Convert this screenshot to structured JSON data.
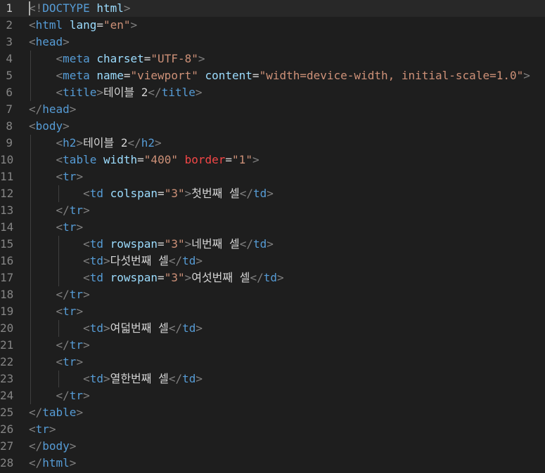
{
  "editor": {
    "language": "html",
    "current_line": 1,
    "colors": {
      "background": "#1e1e1e",
      "punctuation": "#808080",
      "tag": "#569cd6",
      "attribute": "#9cdcfe",
      "unknown_attribute": "#f44747",
      "string": "#ce9178",
      "text": "#d4d4d4",
      "line_number": "#858585"
    },
    "lines": [
      {
        "n": "1",
        "indent": "",
        "tokens": [
          [
            "punct",
            "<!"
          ],
          [
            "tag",
            "DOCTYPE"
          ],
          [
            "text",
            " "
          ],
          [
            "attr",
            "html"
          ],
          [
            "punct",
            ">"
          ]
        ]
      },
      {
        "n": "2",
        "indent": "",
        "tokens": [
          [
            "punct",
            "<"
          ],
          [
            "tag",
            "html"
          ],
          [
            "text",
            " "
          ],
          [
            "attr",
            "lang"
          ],
          [
            "text",
            "="
          ],
          [
            "str",
            "\"en\""
          ],
          [
            "punct",
            ">"
          ]
        ]
      },
      {
        "n": "3",
        "indent": "",
        "tokens": [
          [
            "punct",
            "<"
          ],
          [
            "tag",
            "head"
          ],
          [
            "punct",
            ">"
          ]
        ]
      },
      {
        "n": "4",
        "indent": "    ",
        "tokens": [
          [
            "punct",
            "<"
          ],
          [
            "tag",
            "meta"
          ],
          [
            "text",
            " "
          ],
          [
            "attr",
            "charset"
          ],
          [
            "text",
            "="
          ],
          [
            "str",
            "\"UTF-8\""
          ],
          [
            "punct",
            ">"
          ]
        ]
      },
      {
        "n": "5",
        "indent": "    ",
        "tokens": [
          [
            "punct",
            "<"
          ],
          [
            "tag",
            "meta"
          ],
          [
            "text",
            " "
          ],
          [
            "attr",
            "name"
          ],
          [
            "text",
            "="
          ],
          [
            "str",
            "\"viewport\""
          ],
          [
            "text",
            " "
          ],
          [
            "attr",
            "content"
          ],
          [
            "text",
            "="
          ],
          [
            "str",
            "\"width=device-width, initial-scale=1.0\""
          ],
          [
            "punct",
            ">"
          ]
        ]
      },
      {
        "n": "6",
        "indent": "    ",
        "tokens": [
          [
            "punct",
            "<"
          ],
          [
            "tag",
            "title"
          ],
          [
            "punct",
            ">"
          ],
          [
            "text",
            "테이블 2"
          ],
          [
            "punct",
            "</"
          ],
          [
            "tag",
            "title"
          ],
          [
            "punct",
            ">"
          ]
        ]
      },
      {
        "n": "7",
        "indent": "",
        "tokens": [
          [
            "punct",
            "</"
          ],
          [
            "tag",
            "head"
          ],
          [
            "punct",
            ">"
          ]
        ]
      },
      {
        "n": "8",
        "indent": "",
        "tokens": [
          [
            "punct",
            "<"
          ],
          [
            "tag",
            "body"
          ],
          [
            "punct",
            ">"
          ]
        ]
      },
      {
        "n": "9",
        "indent": "    ",
        "tokens": [
          [
            "punct",
            "<"
          ],
          [
            "tag",
            "h2"
          ],
          [
            "punct",
            ">"
          ],
          [
            "text",
            "테이블 2"
          ],
          [
            "punct",
            "</"
          ],
          [
            "tag",
            "h2"
          ],
          [
            "punct",
            ">"
          ]
        ]
      },
      {
        "n": "10",
        "indent": "    ",
        "tokens": [
          [
            "punct",
            "<"
          ],
          [
            "tag",
            "table"
          ],
          [
            "text",
            " "
          ],
          [
            "attr",
            "width"
          ],
          [
            "text",
            "="
          ],
          [
            "str",
            "\"400\""
          ],
          [
            "text",
            " "
          ],
          [
            "bad",
            "border"
          ],
          [
            "text",
            "="
          ],
          [
            "str",
            "\"1\""
          ],
          [
            "punct",
            ">"
          ]
        ]
      },
      {
        "n": "11",
        "indent": "    ",
        "tokens": [
          [
            "punct",
            "<"
          ],
          [
            "tag",
            "tr"
          ],
          [
            "punct",
            ">"
          ]
        ]
      },
      {
        "n": "12",
        "indent": "        ",
        "tokens": [
          [
            "punct",
            "<"
          ],
          [
            "tag",
            "td"
          ],
          [
            "text",
            " "
          ],
          [
            "attr",
            "colspan"
          ],
          [
            "text",
            "="
          ],
          [
            "str",
            "\"3\""
          ],
          [
            "punct",
            ">"
          ],
          [
            "text",
            "첫번째 셀"
          ],
          [
            "punct",
            "</"
          ],
          [
            "tag",
            "td"
          ],
          [
            "punct",
            ">"
          ]
        ]
      },
      {
        "n": "13",
        "indent": "    ",
        "tokens": [
          [
            "punct",
            "</"
          ],
          [
            "tag",
            "tr"
          ],
          [
            "punct",
            ">"
          ]
        ]
      },
      {
        "n": "14",
        "indent": "    ",
        "tokens": [
          [
            "punct",
            "<"
          ],
          [
            "tag",
            "tr"
          ],
          [
            "punct",
            ">"
          ]
        ]
      },
      {
        "n": "15",
        "indent": "        ",
        "tokens": [
          [
            "punct",
            "<"
          ],
          [
            "tag",
            "td"
          ],
          [
            "text",
            " "
          ],
          [
            "attr",
            "rowspan"
          ],
          [
            "text",
            "="
          ],
          [
            "str",
            "\"3\""
          ],
          [
            "punct",
            ">"
          ],
          [
            "text",
            "네번째 셀"
          ],
          [
            "punct",
            "</"
          ],
          [
            "tag",
            "td"
          ],
          [
            "punct",
            ">"
          ]
        ]
      },
      {
        "n": "16",
        "indent": "        ",
        "tokens": [
          [
            "punct",
            "<"
          ],
          [
            "tag",
            "td"
          ],
          [
            "punct",
            ">"
          ],
          [
            "text",
            "다섯번째 셀"
          ],
          [
            "punct",
            "</"
          ],
          [
            "tag",
            "td"
          ],
          [
            "punct",
            ">"
          ]
        ]
      },
      {
        "n": "17",
        "indent": "        ",
        "tokens": [
          [
            "punct",
            "<"
          ],
          [
            "tag",
            "td"
          ],
          [
            "text",
            " "
          ],
          [
            "attr",
            "rowspan"
          ],
          [
            "text",
            "="
          ],
          [
            "str",
            "\"3\""
          ],
          [
            "punct",
            ">"
          ],
          [
            "text",
            "여섯번째 셀"
          ],
          [
            "punct",
            "</"
          ],
          [
            "tag",
            "td"
          ],
          [
            "punct",
            ">"
          ]
        ]
      },
      {
        "n": "18",
        "indent": "    ",
        "tokens": [
          [
            "punct",
            "</"
          ],
          [
            "tag",
            "tr"
          ],
          [
            "punct",
            ">"
          ]
        ]
      },
      {
        "n": "19",
        "indent": "    ",
        "tokens": [
          [
            "punct",
            "<"
          ],
          [
            "tag",
            "tr"
          ],
          [
            "punct",
            ">"
          ]
        ]
      },
      {
        "n": "20",
        "indent": "        ",
        "tokens": [
          [
            "punct",
            "<"
          ],
          [
            "tag",
            "td"
          ],
          [
            "punct",
            ">"
          ],
          [
            "text",
            "여덟번째 셀"
          ],
          [
            "punct",
            "</"
          ],
          [
            "tag",
            "td"
          ],
          [
            "punct",
            ">"
          ]
        ]
      },
      {
        "n": "21",
        "indent": "    ",
        "tokens": [
          [
            "punct",
            "</"
          ],
          [
            "tag",
            "tr"
          ],
          [
            "punct",
            ">"
          ]
        ]
      },
      {
        "n": "22",
        "indent": "    ",
        "tokens": [
          [
            "punct",
            "<"
          ],
          [
            "tag",
            "tr"
          ],
          [
            "punct",
            ">"
          ]
        ]
      },
      {
        "n": "23",
        "indent": "        ",
        "tokens": [
          [
            "punct",
            "<"
          ],
          [
            "tag",
            "td"
          ],
          [
            "punct",
            ">"
          ],
          [
            "text",
            "열한번째 셀"
          ],
          [
            "punct",
            "</"
          ],
          [
            "tag",
            "td"
          ],
          [
            "punct",
            ">"
          ]
        ]
      },
      {
        "n": "24",
        "indent": "    ",
        "tokens": [
          [
            "punct",
            "</"
          ],
          [
            "tag",
            "tr"
          ],
          [
            "punct",
            ">"
          ]
        ]
      },
      {
        "n": "25",
        "indent": "",
        "tokens": [
          [
            "punct",
            "</"
          ],
          [
            "tag",
            "table"
          ],
          [
            "punct",
            ">"
          ]
        ]
      },
      {
        "n": "26",
        "indent": "",
        "tokens": [
          [
            "punct",
            "<"
          ],
          [
            "tag",
            "tr"
          ],
          [
            "punct",
            ">"
          ]
        ]
      },
      {
        "n": "27",
        "indent": "",
        "tokens": [
          [
            "punct",
            "</"
          ],
          [
            "tag",
            "body"
          ],
          [
            "punct",
            ">"
          ]
        ]
      },
      {
        "n": "28",
        "indent": "",
        "tokens": [
          [
            "punct",
            "</"
          ],
          [
            "tag",
            "html"
          ],
          [
            "punct",
            ">"
          ]
        ]
      }
    ]
  }
}
